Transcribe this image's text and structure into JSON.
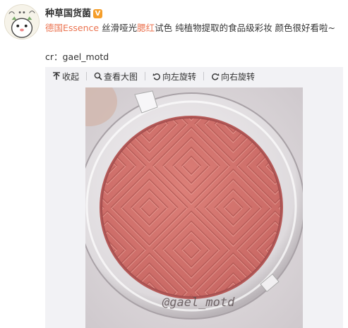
{
  "post": {
    "user_name": "种草国货菌",
    "verified_badge": "V",
    "text_link": "德国Essence",
    "text_part1": " 丝滑哑光",
    "text_highlight": "腮红",
    "text_part2": "试色 纯植物提取的食品级彩妆 颜色很好看啦~",
    "credit": "cr：gael_motd"
  },
  "toolbar": {
    "collapse_label": "收起",
    "view_large_label": "查看大图",
    "rotate_left_label": "向左旋转",
    "rotate_right_label": "向右旋转"
  },
  "image": {
    "watermark": "@gael_motd"
  },
  "colors": {
    "link": "#eb7350",
    "toolbar_bg": "#f2f2f5",
    "blush": "#d4756f",
    "verify": "#f59e2a"
  },
  "icons": [
    "avatar-icon",
    "verified-icon",
    "collapse-icon",
    "zoom-icon",
    "rotate-left-icon",
    "rotate-right-icon"
  ]
}
